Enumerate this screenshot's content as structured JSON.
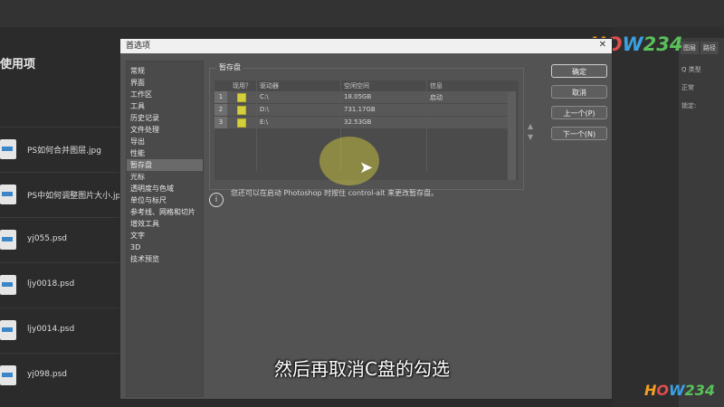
{
  "background": {
    "recent_title": "使用项",
    "files": [
      {
        "name": "PS如何合并图层.jpg"
      },
      {
        "name": "PS中如何调整图片大小.jpg"
      },
      {
        "name": "yj055.psd"
      },
      {
        "name": "ljy0018.psd"
      },
      {
        "name": "ljy0014.psd"
      },
      {
        "name": "yj098.psd"
      }
    ]
  },
  "dock": {
    "tabs": [
      "图层",
      "路径"
    ],
    "search_placeholder": "Q 类型",
    "blend_mode": "正常",
    "lock_label": "锁定:"
  },
  "watermark": {
    "text_top": "HOW234",
    "text_bottom": "HOW234",
    "color": "#f0a020"
  },
  "dialog": {
    "title": "首选项",
    "close_glyph": "✕",
    "nav_items": [
      "常规",
      "界面",
      "工作区",
      "工具",
      "历史记录",
      "文件处理",
      "导出",
      "性能",
      "暂存盘",
      "光标",
      "透明度与色域",
      "单位与标尺",
      "参考线、网格和切片",
      "增效工具",
      "文字",
      "3D",
      "技术预览"
    ],
    "active_nav": "暂存盘",
    "section_title": "暂存盘",
    "table": {
      "headers": [
        "现用？",
        "驱动器",
        "空闲空间",
        "信息"
      ],
      "rows": [
        {
          "num": "1",
          "active": true,
          "drive": "C:\\",
          "space": "18.05GB",
          "info": "启动"
        },
        {
          "num": "2",
          "active": true,
          "drive": "D:\\",
          "space": "731.17GB",
          "info": ""
        },
        {
          "num": "3",
          "active": true,
          "drive": "E:\\",
          "space": "32.53GB",
          "info": ""
        }
      ]
    },
    "info_text": "您还可以在启动 Photoshop 时按住 control-alt 来更改暂存盘。",
    "buttons": {
      "ok": "确定",
      "cancel": "取消",
      "prev": "上一个(P)",
      "next": "下一个(N)"
    },
    "checkbox_color": "#d4cf3a",
    "highlight_color": "#e6e13c"
  },
  "caption": "然后再取消C盘的勾选"
}
